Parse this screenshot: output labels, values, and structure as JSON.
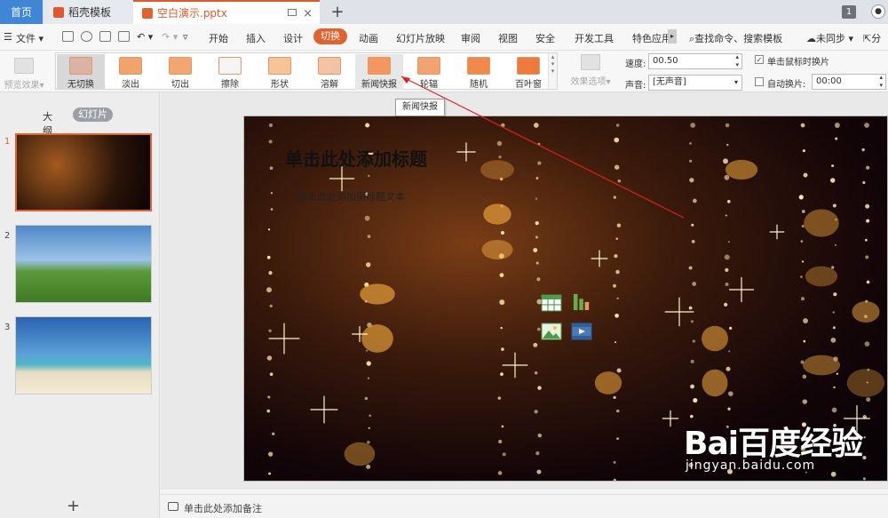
{
  "tabs": {
    "home": "首页",
    "templates": "稻壳模板",
    "file": "空白演示.pptx",
    "new_tab": "+",
    "badge_count": "1"
  },
  "menu": {
    "file": "文件",
    "items": [
      "开始",
      "插入",
      "设计",
      "切换",
      "动画",
      "幻灯片放映",
      "审阅",
      "视图",
      "安全",
      "开发工具",
      "特色应用"
    ],
    "search": "查找命令、搜索模板",
    "sync": "未同步",
    "share": "分"
  },
  "ribbon": {
    "preview_effect": "预览效果",
    "effects": [
      {
        "label": "无切换",
        "color": "#d9b4a4"
      },
      {
        "label": "淡出",
        "color": "#f0a46c"
      },
      {
        "label": "切出",
        "color": "#f4a670"
      },
      {
        "label": "擦除",
        "color": "#f5f5f5"
      },
      {
        "label": "形状",
        "color": "#f7c49a"
      },
      {
        "label": "溶解",
        "color": "#f4c3a6"
      },
      {
        "label": "新闻快报",
        "color": "#f3975e"
      },
      {
        "label": "轮辐",
        "color": "#f3a36f"
      },
      {
        "label": "随机",
        "color": "#f08a4c"
      },
      {
        "label": "百叶窗",
        "color": "#ee7b3c"
      }
    ],
    "effect_options": "效果选项",
    "speed_label": "速度:",
    "speed_value": "00.50",
    "sound_label": "声音:",
    "sound_value": "[无声音]",
    "on_click_label": "单击鼠标时换片",
    "on_click_checked": true,
    "auto_label": "自动换片:",
    "auto_value": "00:00",
    "auto_checked": false
  },
  "tooltip": "新闻快报",
  "left_panel": {
    "outline_tab": "大纲",
    "slides_tab": "幻灯片",
    "slide_numbers": [
      "1",
      "2",
      "3"
    ],
    "add_slide": "+"
  },
  "slide": {
    "title_placeholder": "单击此处添加标题",
    "subtitle_placeholder": "单击此处添加副标题文本"
  },
  "status": {
    "notes_placeholder": "单击此处添加备注"
  },
  "watermark": {
    "logo": "Bai百度经验",
    "url": "jingyan.baidu.com"
  }
}
